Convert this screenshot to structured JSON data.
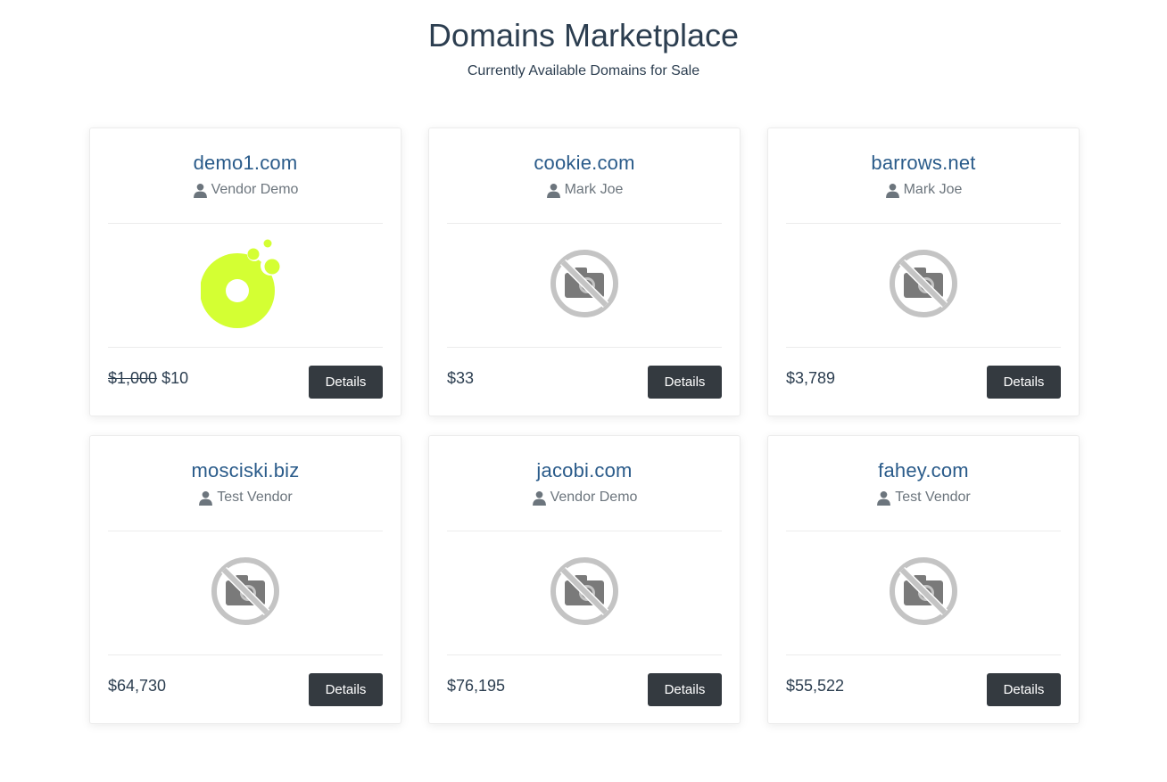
{
  "header": {
    "title": "Domains Marketplace",
    "subtitle": "Currently Available Domains for Sale"
  },
  "colors": {
    "domain_link": "#2a5b8a",
    "button_bg": "#343a40",
    "logo_accent": "#d4ff33",
    "placeholder_gray": "#c4c4c4"
  },
  "listings": [
    {
      "domain": "demo1.com",
      "vendor": "Vendor Demo",
      "old_price": "$1,000",
      "price": "$10",
      "image": "donut-logo",
      "button": "Details"
    },
    {
      "domain": "cookie.com",
      "vendor": "Mark Joe",
      "old_price": "",
      "price": "$33",
      "image": "no-photo-icon",
      "button": "Details"
    },
    {
      "domain": "barrows.net",
      "vendor": "Mark Joe",
      "old_price": "",
      "price": "$3,789",
      "image": "no-photo-icon",
      "button": "Details"
    },
    {
      "domain": "mosciski.biz",
      "vendor": "Test Vendor",
      "old_price": "",
      "price": "$64,730",
      "image": "no-photo-icon",
      "button": "Details"
    },
    {
      "domain": "jacobi.com",
      "vendor": "Vendor Demo",
      "old_price": "",
      "price": "$76,195",
      "image": "no-photo-icon",
      "button": "Details"
    },
    {
      "domain": "fahey.com",
      "vendor": "Test Vendor",
      "old_price": "",
      "price": "$55,522",
      "image": "no-photo-icon",
      "button": "Details"
    }
  ]
}
